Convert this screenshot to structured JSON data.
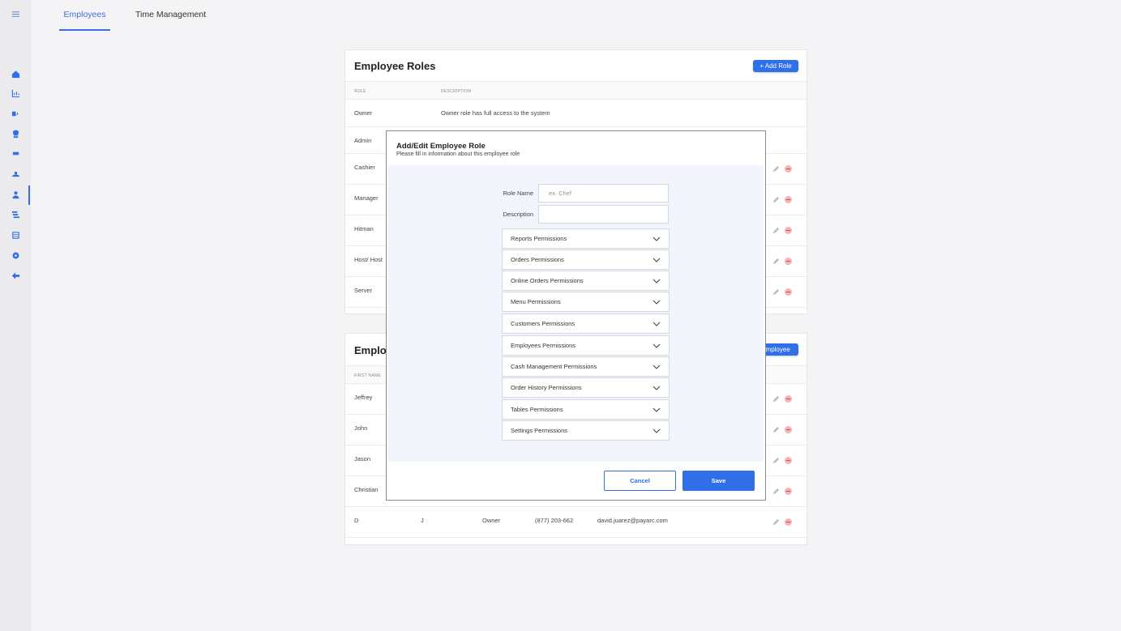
{
  "sidebar": {
    "menu_icon": "hamburger-icon",
    "items": [
      {
        "icon": "home-icon"
      },
      {
        "icon": "chart-icon"
      },
      {
        "icon": "tag-icon"
      },
      {
        "icon": "chef-hat-icon"
      },
      {
        "icon": "menu-card-icon"
      },
      {
        "icon": "customers-icon"
      },
      {
        "icon": "employees-icon",
        "active": true
      },
      {
        "icon": "history-icon"
      },
      {
        "icon": "table-icon"
      },
      {
        "icon": "settings-icon"
      },
      {
        "icon": "logout-icon"
      }
    ]
  },
  "tabs": [
    {
      "label": "Employees",
      "active": true
    },
    {
      "label": "Time Management",
      "active": false
    }
  ],
  "roles_card": {
    "title": "Employee Roles",
    "add_button": "+ Add Role",
    "columns": [
      "ROLE",
      "DESCRIPTION"
    ],
    "rows": [
      {
        "role": "Owner",
        "description": "Owner role has full access to the system"
      },
      {
        "role": "Admin",
        "description": ""
      },
      {
        "role": "Cashier",
        "description": ""
      },
      {
        "role": "Manager",
        "description": ""
      },
      {
        "role": "Hitman",
        "description": ""
      },
      {
        "role": "Host/ Host",
        "description": ""
      },
      {
        "role": "Server",
        "description": ""
      }
    ]
  },
  "employees_card": {
    "title": "Employ",
    "add_button": "Employee",
    "columns": [
      "FIRST NAME"
    ],
    "rows": [
      {
        "first": "Jeffrey",
        "last": "",
        "role": "",
        "phone": "",
        "email": ""
      },
      {
        "first": "John",
        "last": "",
        "role": "",
        "phone": "",
        "email": ""
      },
      {
        "first": "Jason",
        "last": "",
        "role": "",
        "phone": "",
        "email": ""
      },
      {
        "first": "Christian",
        "last": "",
        "role": "",
        "phone": "",
        "email": ""
      },
      {
        "first": "D",
        "last": "J",
        "role": "Owner",
        "phone": "(877) 203-662",
        "email": "david.juarez@payarc.com"
      }
    ]
  },
  "modal": {
    "title": "Add/Edit Employee Role",
    "subtitle": "Please fill in information about this employee role",
    "role_name_label": "Role Name",
    "role_name_placeholder": "ex. Chef",
    "role_name_value": "",
    "description_label": "Description",
    "description_value": "",
    "permissions": [
      "Reports Permissions",
      "Orders Permissions",
      "Online Orders Permissions",
      "Menu Permissions",
      "Customers Permissions",
      "Employees Permissions",
      "Cash Management Permissions",
      "Order History Permissions",
      "Tables Permissions",
      "Settings Permissions"
    ],
    "cancel_label": "Cancel",
    "save_label": "Save"
  },
  "colors": {
    "accent": "#2f6fe8",
    "delete": "#e04444"
  }
}
